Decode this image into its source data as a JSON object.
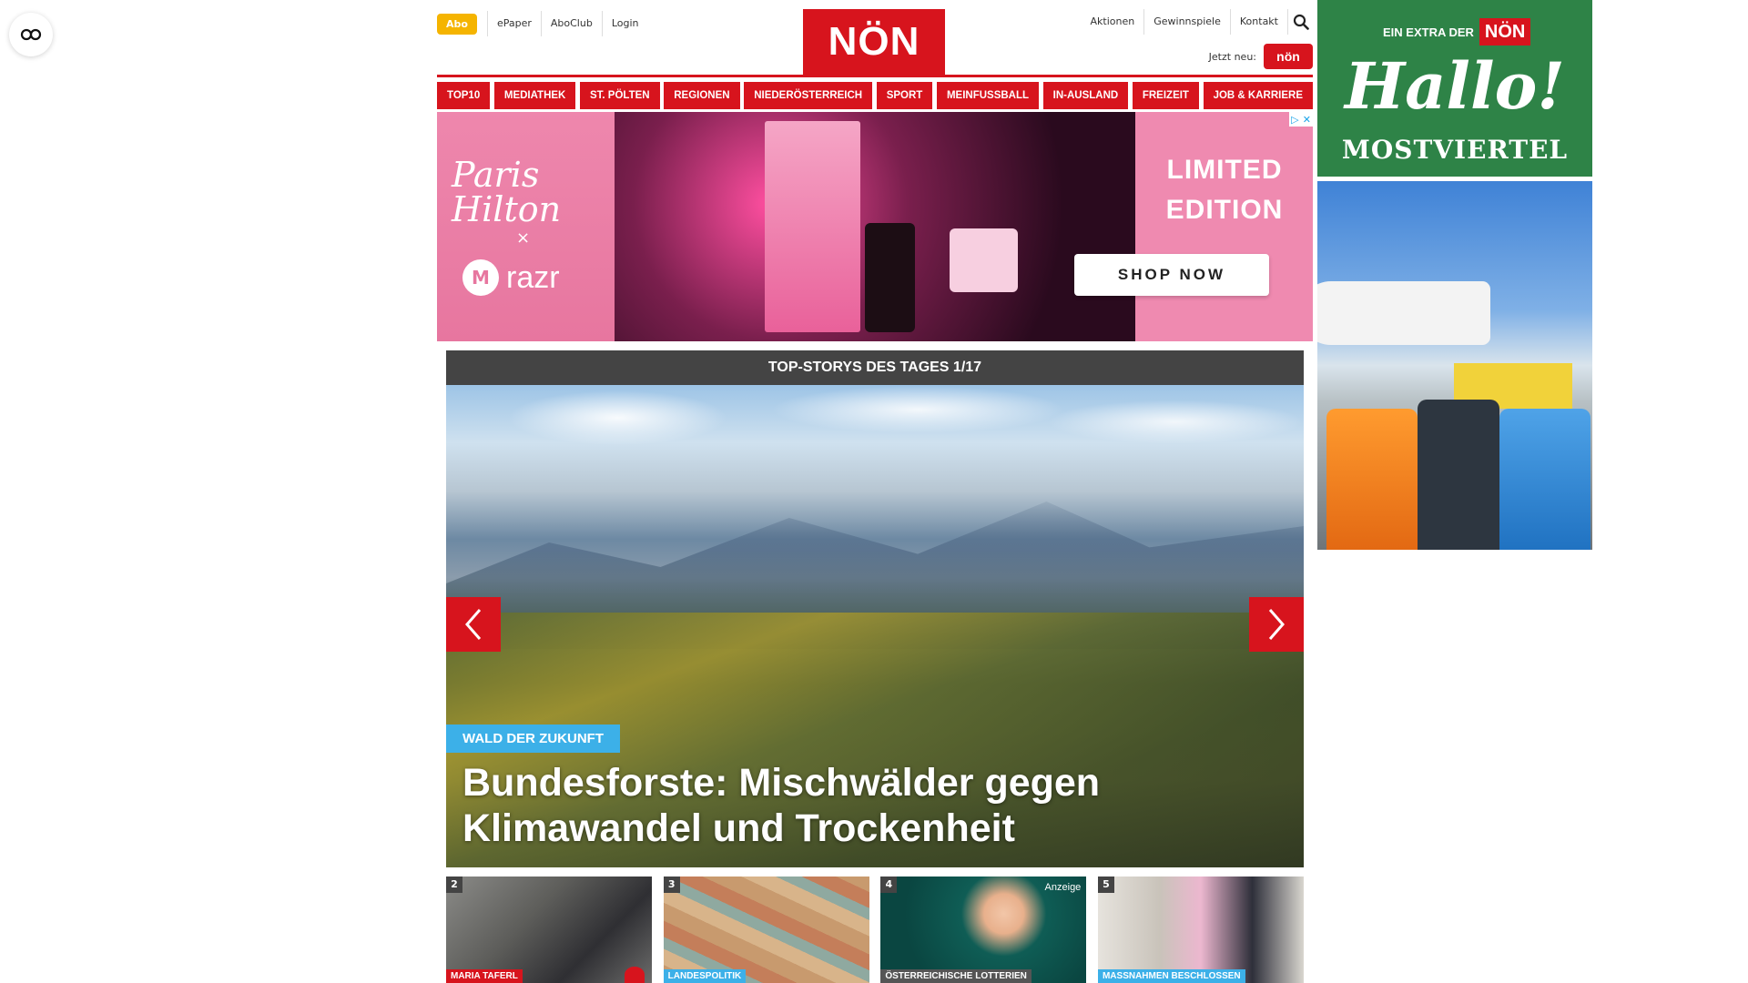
{
  "accessibility": {
    "icon": "glasses-icon"
  },
  "topnav_left": {
    "abo": "Abo",
    "links": [
      "ePaper",
      "AboClub",
      "Login"
    ]
  },
  "logo": {
    "text": "NÖN"
  },
  "topnav_right": {
    "links": [
      "Aktionen",
      "Gewinnspiele",
      "Kontakt"
    ],
    "search_icon": "search-icon",
    "jetzt_neu": "Jetzt neu:",
    "jetzt_logo": "nön"
  },
  "mainnav": {
    "items": [
      "TOP10",
      "MEDIATHEK",
      "ST. PÖLTEN",
      "REGIONEN",
      "NIEDERÖSTERREICH",
      "SPORT",
      "MEINFUSSBALL",
      "IN-AUSLAND",
      "FREIZEIT",
      "JOB & KARRIERE"
    ]
  },
  "ad_banner": {
    "brand": "Paris Hilton",
    "x": "×",
    "razr": "razr",
    "limited_line1": "LIMITED",
    "limited_line2": "EDITION",
    "shop": "SHOP NOW"
  },
  "stories": {
    "header": "TOP-STORYS DES TAGES 1/17",
    "hero_tag": "WALD DER ZUKUNFT",
    "hero_title": "Bundesforste: Mischwälder gegen Klimawandel und Trockenheit",
    "thumbs": [
      {
        "num": "2",
        "category": "MARIA TAFERL",
        "cat_color": "#d7141d"
      },
      {
        "num": "3",
        "category": "LANDESPOLITIK",
        "cat_color": "#3cb0e8"
      },
      {
        "num": "4",
        "category": "ÖSTERREICHISCHE LOTTERIEN",
        "cat_color": "#555555",
        "badge": "Anzeige"
      },
      {
        "num": "5",
        "category": "MASSNAHMEN BESCHLOSSEN",
        "cat_color": "#3cb0e8"
      }
    ]
  },
  "side_ad": {
    "extra": "EIN EXTRA DER",
    "mini_logo": "NÖN",
    "hallo": "Hallo!",
    "region": "MOSTVIERTEL"
  },
  "colors": {
    "brand_red": "#d7141d",
    "accent_blue": "#3cb0e8",
    "abo_yellow": "#f5b400",
    "side_green": "#2e8347"
  }
}
